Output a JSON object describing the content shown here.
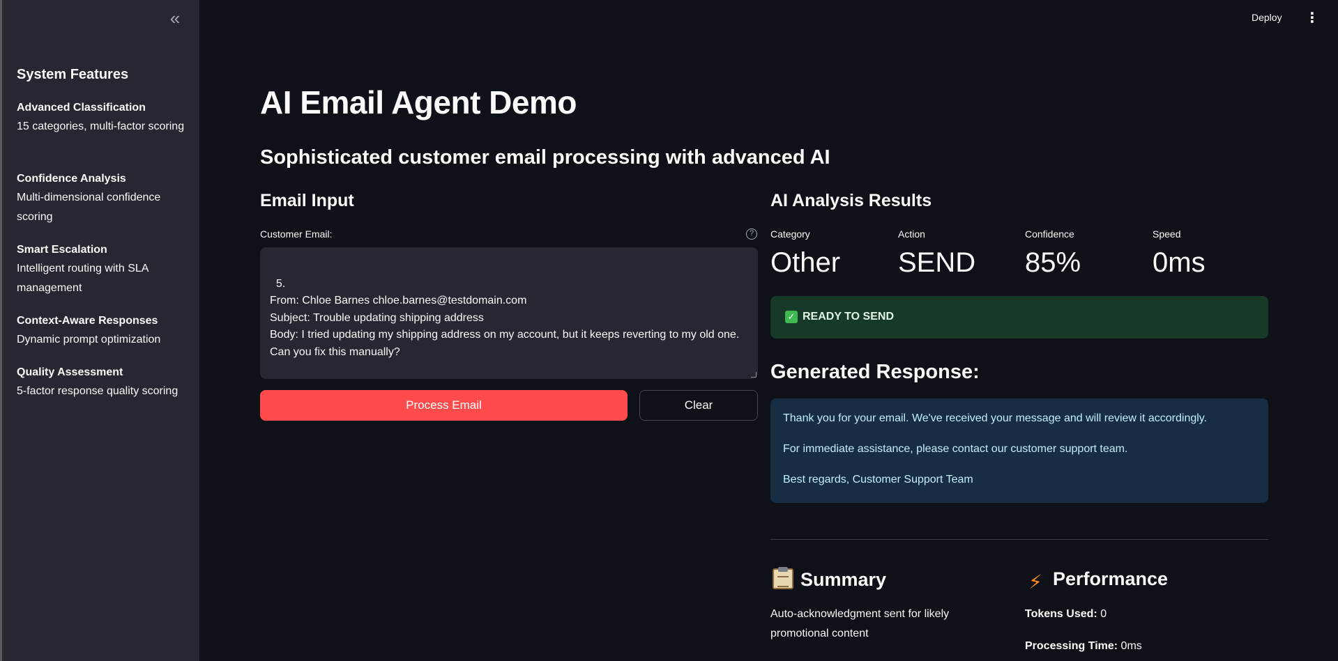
{
  "sidebar": {
    "collapse_icon": "«",
    "title": "System Features",
    "features": [
      {
        "name": "Advanced Classification",
        "desc": "15 categories, multi-factor scoring"
      },
      {
        "name": "Confidence Analysis",
        "desc": "Multi-dimensional confidence scoring"
      },
      {
        "name": "Smart Escalation",
        "desc": "Intelligent routing with SLA management"
      },
      {
        "name": "Context-Aware Responses",
        "desc": "Dynamic prompt optimization"
      },
      {
        "name": "Quality Assessment",
        "desc": "5-factor response quality scoring"
      }
    ]
  },
  "header": {
    "deploy_label": "Deploy",
    "menu_icon": "⋮"
  },
  "main": {
    "title": "AI Email Agent Demo",
    "subtitle": "Sophisticated customer email processing with advanced AI",
    "input": {
      "heading": "Email Input",
      "label": "Customer Email:",
      "help_icon": "?",
      "value": "5.\nFrom: Chloe Barnes chloe.barnes@testdomain.com\nSubject: Trouble updating shipping address\nBody: I tried updating my shipping address on my account, but it keeps reverting to my old one. Can you fix this manually?",
      "process_label": "Process Email",
      "clear_label": "Clear"
    },
    "results": {
      "heading": "AI Analysis Results",
      "metrics": [
        {
          "label": "Category",
          "value": "Other"
        },
        {
          "label": "Action",
          "value": "SEND"
        },
        {
          "label": "Confidence",
          "value": "85%"
        },
        {
          "label": "Speed",
          "value": "0ms"
        }
      ],
      "status_icon": "✓",
      "status_text": "READY TO SEND",
      "response_heading": "Generated Response:",
      "response_paragraphs": [
        "Thank you for your email. We've received your message and will review it accordingly.",
        "For immediate assistance, please contact our customer support team.",
        "Best regards, Customer Support Team"
      ],
      "summary_heading": "Summary",
      "summary_text": "Auto-acknowledgment sent for likely promotional content",
      "performance_heading": "Performance",
      "performance_icon": "⚡",
      "tokens_label": "Tokens Used:",
      "tokens_value": "0",
      "time_label": "Processing Time:",
      "time_value": "0ms"
    }
  },
  "colors": {
    "primary": "#ff4b4b",
    "success_bg": "#173928",
    "info_bg": "#172d43",
    "sidebar_bg": "#262730",
    "app_bg": "#0e1117"
  }
}
